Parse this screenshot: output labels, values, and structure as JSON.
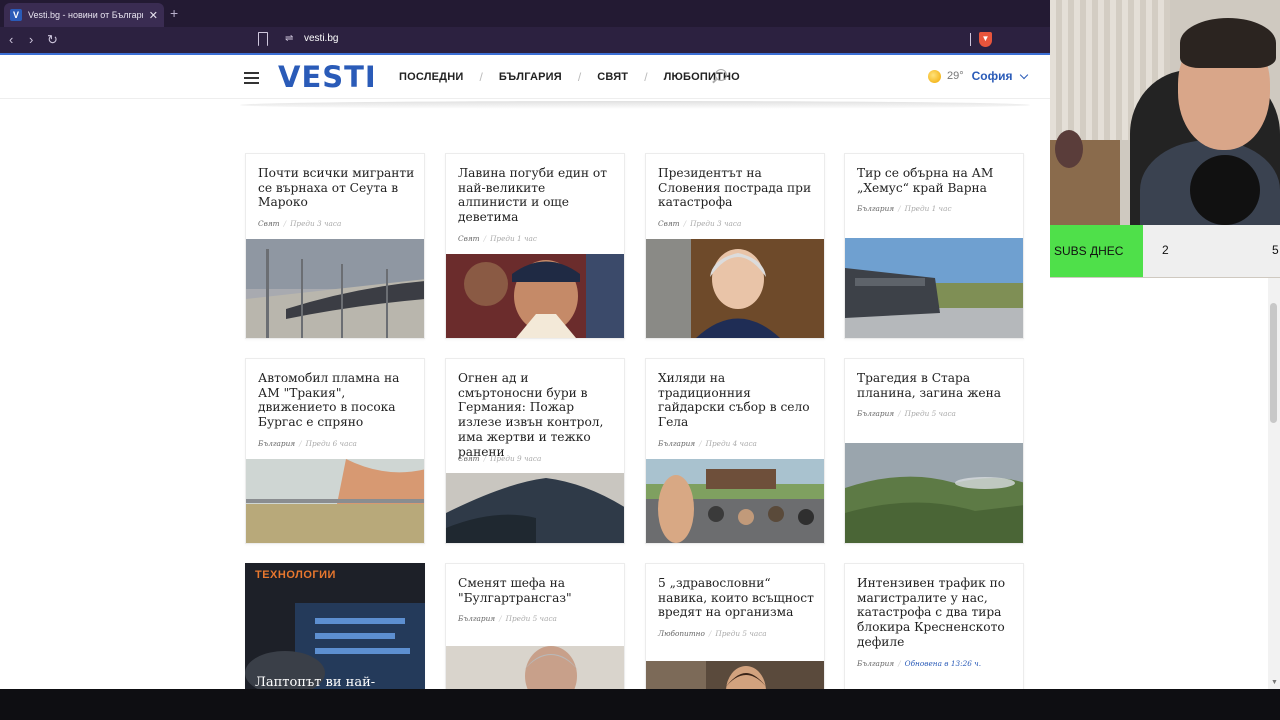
{
  "browser": {
    "tab_title": "Vesti.bg - новини от България и",
    "tab_close": "✕",
    "new_tab": "+",
    "favicon_letter": "V",
    "url": "vesti.bg",
    "shield_glyph": "▼"
  },
  "header": {
    "logo": "VESTI",
    "nav": [
      "ПОСЛЕДНИ",
      "БЪЛГАРИЯ",
      "СВЯТ",
      "ЛЮБОПИТНО"
    ],
    "separator": "/",
    "temperature": "29°",
    "city": "София"
  },
  "articles": [
    {
      "title": "Почти всички мигранти се върнаха от Сеута в Мароко",
      "category": "Свят",
      "time": "Преди 3 часа"
    },
    {
      "title": "Лавина погуби един от най-великите алпинисти и още деветима",
      "category": "Свят",
      "time": "Преди 1 час"
    },
    {
      "title": "Президентът на Словения пострада при катастрофа",
      "category": "Свят",
      "time": "Преди 3 часа"
    },
    {
      "title": "Тир се обърна на АМ „Хемус“ край Варна",
      "category": "България",
      "time": "Преди 1 час"
    },
    {
      "title": "Автомобил пламна на АМ \"Тракия\", движението в посока Бургас е спряно",
      "category": "България",
      "time": "Преди 6 часа"
    },
    {
      "title": "Огнен ад и смъртоносни бури в Германия: Пожар излезе извън контрол, има жертви и тежко ранени",
      "category": "Свят",
      "time": "Преди 9 часа"
    },
    {
      "title": "Хиляди на традиционния гайдарски събор в село Гела",
      "category": "България",
      "time": "Преди 4 часа"
    },
    {
      "title": "Трагедия в Стара планина, загина жена",
      "category": "България",
      "time": "Преди 5 часа"
    },
    {
      "title": "",
      "category": "",
      "time": "",
      "label": "ТЕХНОЛОГИИ",
      "caption": "Лаптопът ви най-"
    },
    {
      "title": "Сменят шефа на \"Булгартрансгаз\"",
      "category": "България",
      "time": "Преди 5 часа"
    },
    {
      "title": "5 „здравословни“ навика, които всъщност вредят на организма",
      "category": "Любопитно",
      "time": "Преди 5 часа"
    },
    {
      "title": "Интензивен трафик по магистралите у нас, катастрофа с два тира блокира Кресненското дефиле",
      "category": "България",
      "time": "Обновена в 13:26 ч."
    }
  ],
  "meta_separator": "/",
  "overlay": {
    "subs_label": "SUBS ДНЕС",
    "subs_value_1": "2",
    "subs_value_2": "5"
  }
}
